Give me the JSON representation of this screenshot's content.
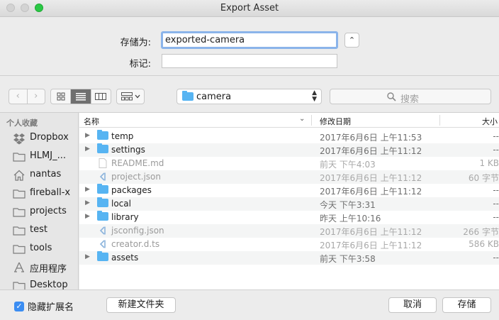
{
  "window": {
    "title": "Export Asset"
  },
  "save_as": {
    "label": "存储为:",
    "value": "exported-camera"
  },
  "tags": {
    "label": "标记:",
    "value": ""
  },
  "toolbar": {
    "back_label": "‹",
    "forward_label": "›",
    "location": "camera",
    "search_placeholder": "搜索"
  },
  "sidebar": {
    "heading": "个人收藏",
    "items": [
      {
        "label": "Dropbox",
        "icon": "dropbox-icon"
      },
      {
        "label": "HLMJ_...",
        "icon": "folder-icon"
      },
      {
        "label": "nantas",
        "icon": "home-icon"
      },
      {
        "label": "fireball-x",
        "icon": "folder-icon"
      },
      {
        "label": "projects",
        "icon": "folder-icon"
      },
      {
        "label": "test",
        "icon": "folder-icon"
      },
      {
        "label": "tools",
        "icon": "folder-icon"
      },
      {
        "label": "应用程序",
        "icon": "applications-icon"
      },
      {
        "label": "Desktop",
        "icon": "folder-icon"
      }
    ]
  },
  "list": {
    "columns": {
      "name": "名称",
      "date": "修改日期",
      "size": "大小"
    },
    "rows": [
      {
        "name": "temp",
        "date": "2017年6月6日 上午11:53",
        "size": "--",
        "kind": "folder"
      },
      {
        "name": "settings",
        "date": "2017年6月6日 上午11:12",
        "size": "--",
        "kind": "folder"
      },
      {
        "name": "README.md",
        "date": "前天 下午4:03",
        "size": "1 KB",
        "kind": "file"
      },
      {
        "name": "project.json",
        "date": "2017年6月6日 上午11:12",
        "size": "60 字节",
        "kind": "json"
      },
      {
        "name": "packages",
        "date": "2017年6月6日 上午11:12",
        "size": "--",
        "kind": "folder"
      },
      {
        "name": "local",
        "date": "今天 下午3:31",
        "size": "--",
        "kind": "folder"
      },
      {
        "name": "library",
        "date": "昨天 上午10:16",
        "size": "--",
        "kind": "folder"
      },
      {
        "name": "jsconfig.json",
        "date": "2017年6月6日 上午11:12",
        "size": "266 字节",
        "kind": "json"
      },
      {
        "name": "creator.d.ts",
        "date": "2017年6月6日 上午11:12",
        "size": "586 KB",
        "kind": "json"
      },
      {
        "name": "assets",
        "date": "前天 下午3:58",
        "size": "--",
        "kind": "folder"
      }
    ]
  },
  "bottom": {
    "hide_extension_label": "隐藏扩展名",
    "hide_extension_checked": true,
    "new_folder_label": "新建文件夹",
    "cancel_label": "取消",
    "save_label": "存储"
  },
  "colors": {
    "accent": "#3b8df2",
    "folder": "#57b4f2",
    "focus_ring": "#8bb4ea"
  }
}
